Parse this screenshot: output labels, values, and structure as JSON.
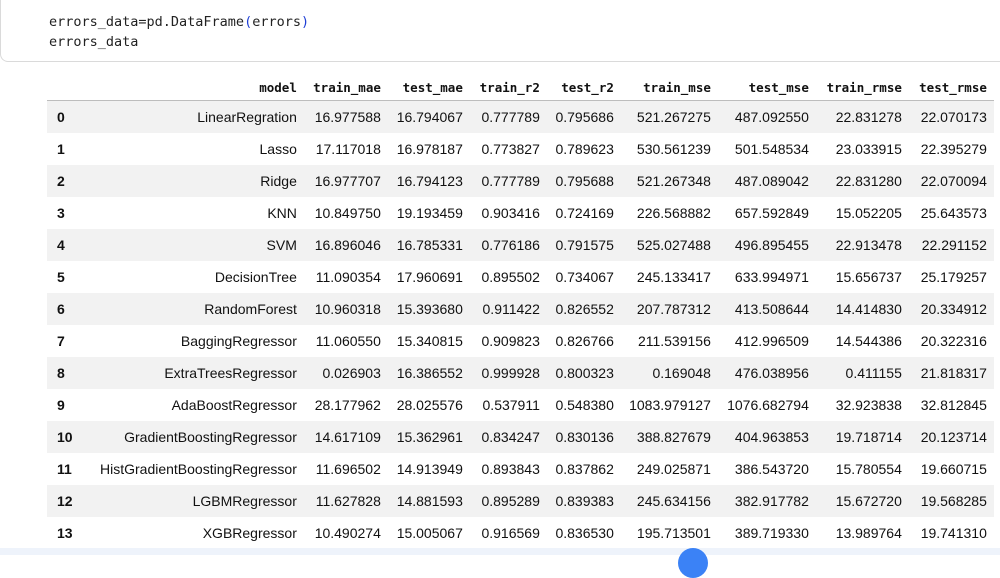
{
  "code_cell": {
    "line1_pre": "errors_data=pd.DataFrame",
    "line1_open": "(",
    "line1_arg": "errors",
    "line1_close": ")",
    "line2": "errors_data"
  },
  "table": {
    "columns": [
      "",
      "model",
      "train_mae",
      "test_mae",
      "train_r2",
      "test_r2",
      "train_mse",
      "test_mse",
      "train_rmse",
      "test_rmse"
    ],
    "rows": [
      [
        "0",
        "LinearRegration",
        "16.977588",
        "16.794067",
        "0.777789",
        "0.795686",
        "521.267275",
        "487.092550",
        "22.831278",
        "22.070173"
      ],
      [
        "1",
        "Lasso",
        "17.117018",
        "16.978187",
        "0.773827",
        "0.789623",
        "530.561239",
        "501.548534",
        "23.033915",
        "22.395279"
      ],
      [
        "2",
        "Ridge",
        "16.977707",
        "16.794123",
        "0.777789",
        "0.795688",
        "521.267348",
        "487.089042",
        "22.831280",
        "22.070094"
      ],
      [
        "3",
        "KNN",
        "10.849750",
        "19.193459",
        "0.903416",
        "0.724169",
        "226.568882",
        "657.592849",
        "15.052205",
        "25.643573"
      ],
      [
        "4",
        "SVM",
        "16.896046",
        "16.785331",
        "0.776186",
        "0.791575",
        "525.027488",
        "496.895455",
        "22.913478",
        "22.291152"
      ],
      [
        "5",
        "DecisionTree",
        "11.090354",
        "17.960691",
        "0.895502",
        "0.734067",
        "245.133417",
        "633.994971",
        "15.656737",
        "25.179257"
      ],
      [
        "6",
        "RandomForest",
        "10.960318",
        "15.393680",
        "0.911422",
        "0.826552",
        "207.787312",
        "413.508644",
        "14.414830",
        "20.334912"
      ],
      [
        "7",
        "BaggingRegressor",
        "11.060550",
        "15.340815",
        "0.909823",
        "0.826766",
        "211.539156",
        "412.996509",
        "14.544386",
        "20.322316"
      ],
      [
        "8",
        "ExtraTreesRegressor",
        "0.026903",
        "16.386552",
        "0.999928",
        "0.800323",
        "0.169048",
        "476.038956",
        "0.411155",
        "21.818317"
      ],
      [
        "9",
        "AdaBoostRegressor",
        "28.177962",
        "28.025576",
        "0.537911",
        "0.548380",
        "1083.979127",
        "1076.682794",
        "32.923838",
        "32.812845"
      ],
      [
        "10",
        "GradientBoostingRegressor",
        "14.617109",
        "15.362961",
        "0.834247",
        "0.830136",
        "388.827679",
        "404.963853",
        "19.718714",
        "20.123714"
      ],
      [
        "11",
        "HistGradientBoostingRegressor",
        "11.696502",
        "14.913949",
        "0.893843",
        "0.837862",
        "249.025871",
        "386.543720",
        "15.780554",
        "19.660715"
      ],
      [
        "12",
        "LGBMRegressor",
        "11.627828",
        "14.881593",
        "0.895289",
        "0.839383",
        "245.634156",
        "382.917782",
        "15.672720",
        "19.568285"
      ],
      [
        "13",
        "XGBRegressor",
        "10.490274",
        "15.005067",
        "0.916569",
        "0.836530",
        "195.713501",
        "389.719330",
        "13.989764",
        "19.741310"
      ]
    ]
  }
}
